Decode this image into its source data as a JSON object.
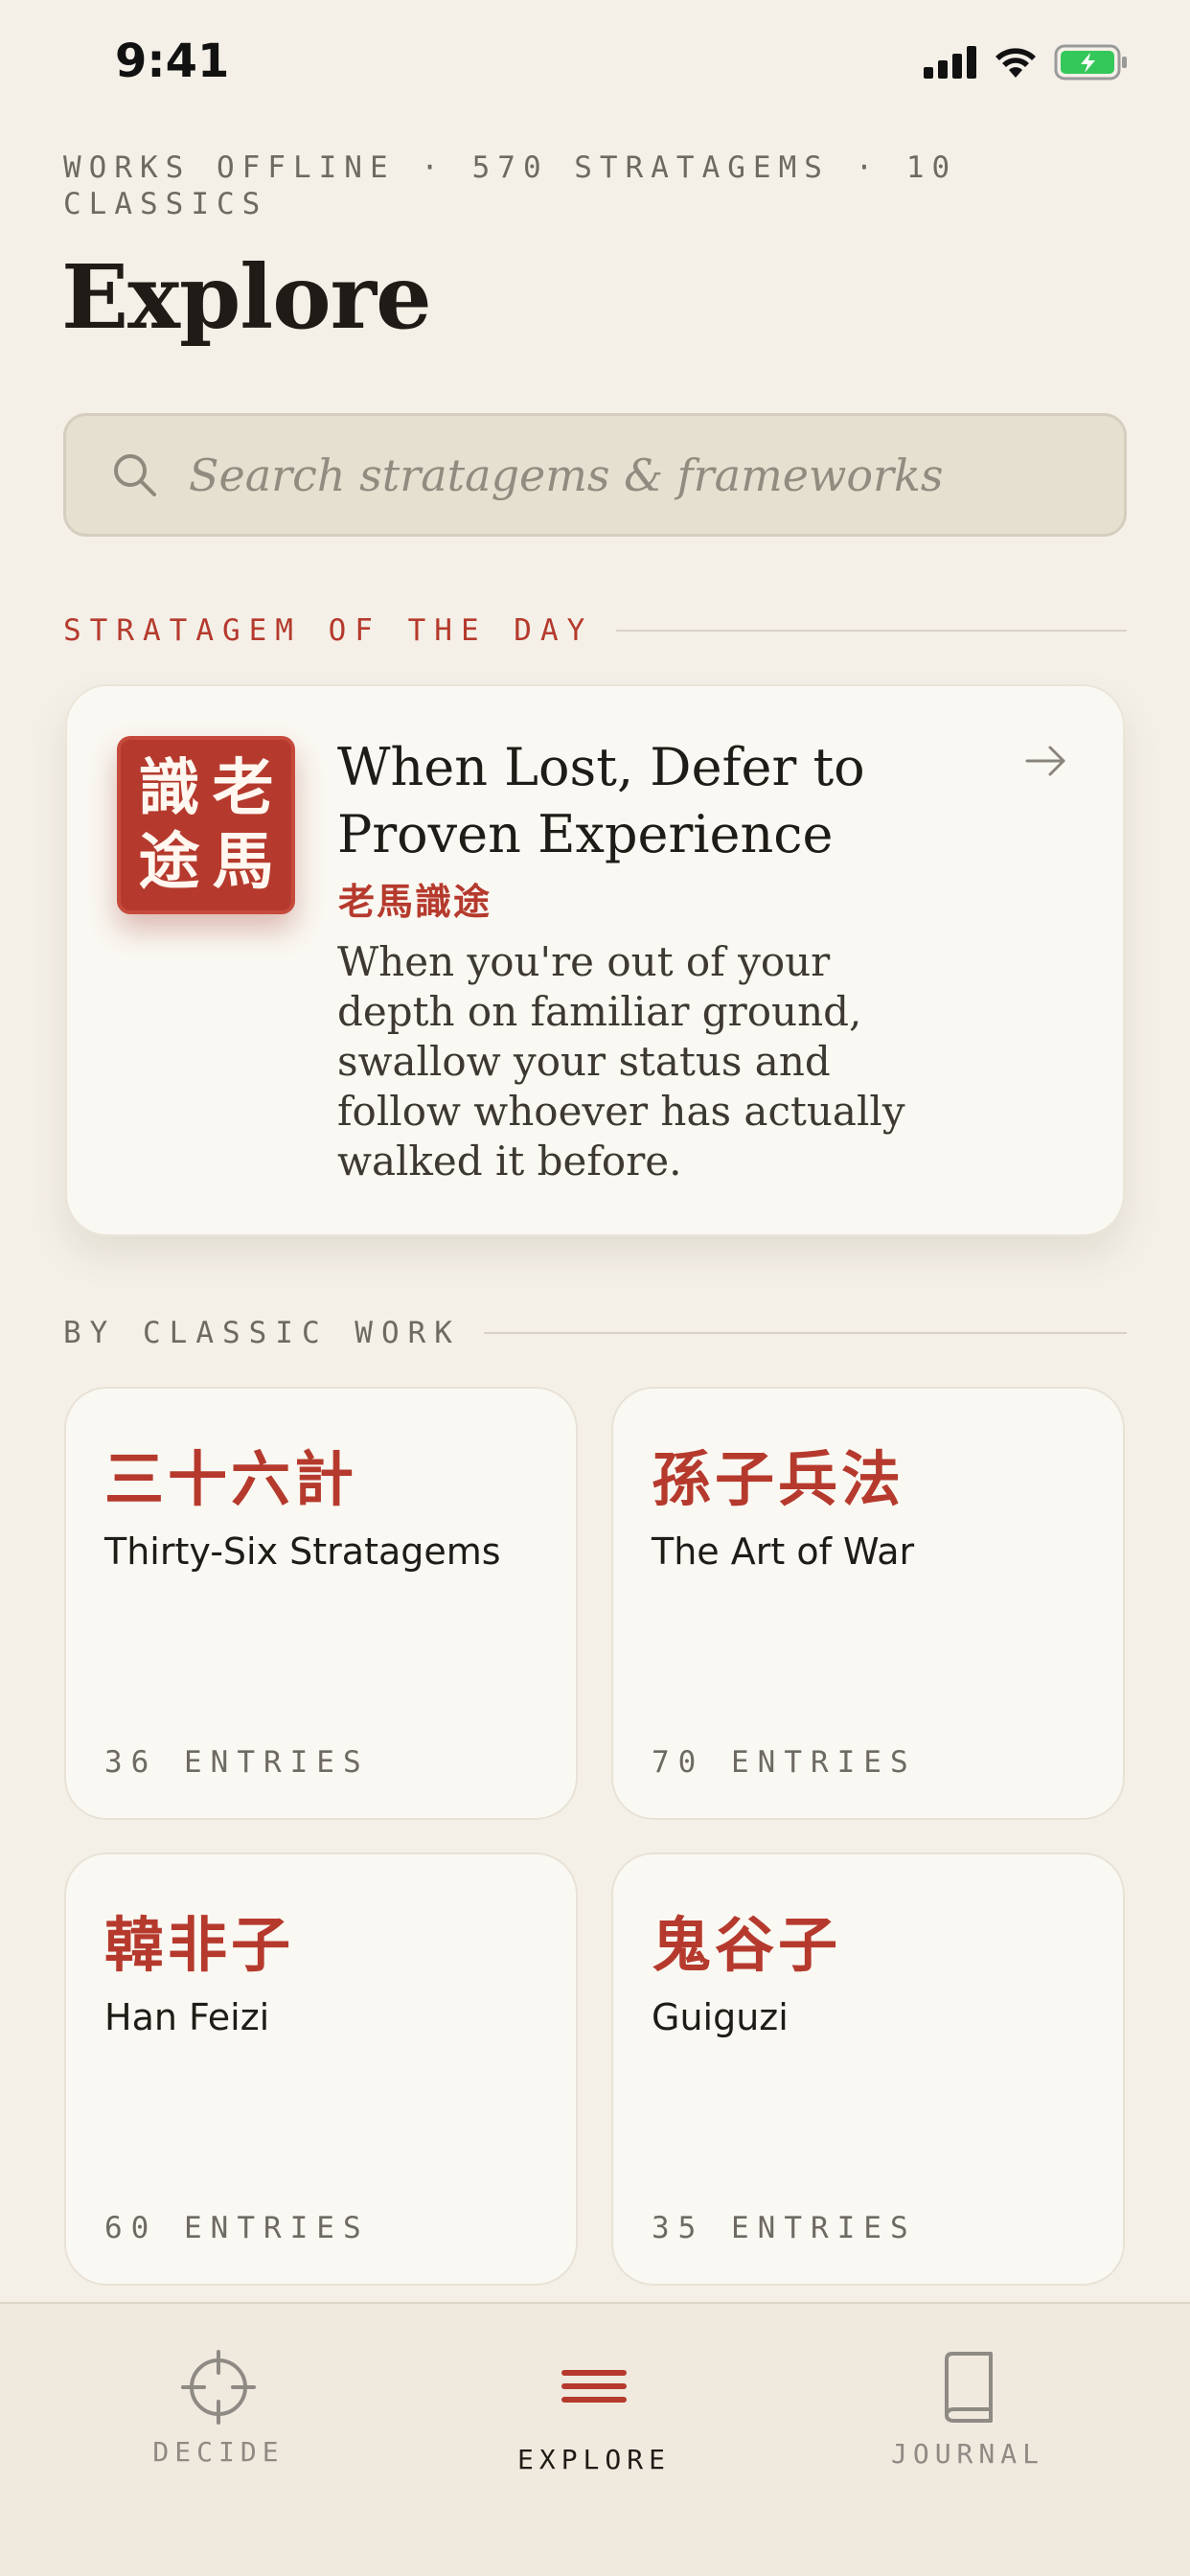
{
  "status_bar": {
    "time": "9:41"
  },
  "header": {
    "meta": "WORKS OFFLINE · 570 STRATAGEMS · 10 CLASSICS",
    "title": "Explore"
  },
  "search": {
    "placeholder": "Search stratagems & frameworks"
  },
  "stratagem_of_the_day": {
    "section_label": "STRATAGEM OF THE DAY",
    "seal_chars": [
      "識",
      "老",
      "途",
      "馬"
    ],
    "title": "When Lost, Defer to Proven Experience",
    "chinese": "老馬識途",
    "description": "When you're out of your depth on familiar ground, swallow your status and follow whoever has actually walked it before."
  },
  "classics": {
    "section_label": "BY CLASSIC WORK",
    "works": [
      {
        "chinese": "三十六計",
        "english": "Thirty-Six Stratagems",
        "count": "36 ENTRIES"
      },
      {
        "chinese": "孫子兵法",
        "english": "The Art of War",
        "count": "70 ENTRIES"
      },
      {
        "chinese": "韓非子",
        "english": "Han Feizi",
        "count": "60 ENTRIES"
      },
      {
        "chinese": "鬼谷子",
        "english": "Guiguzi",
        "count": "35 ENTRIES"
      }
    ]
  },
  "tab_bar": {
    "tabs": [
      {
        "label": "DECIDE",
        "icon": "crosshair-icon",
        "active": false
      },
      {
        "label": "EXPLORE",
        "icon": "menu-lines-icon",
        "active": true
      },
      {
        "label": "JOURNAL",
        "icon": "book-icon",
        "active": false
      }
    ]
  },
  "colors": {
    "accent": "#b53a2d",
    "background": "#f4f0e8",
    "card": "#faf8f2",
    "battery": "#34c759"
  }
}
